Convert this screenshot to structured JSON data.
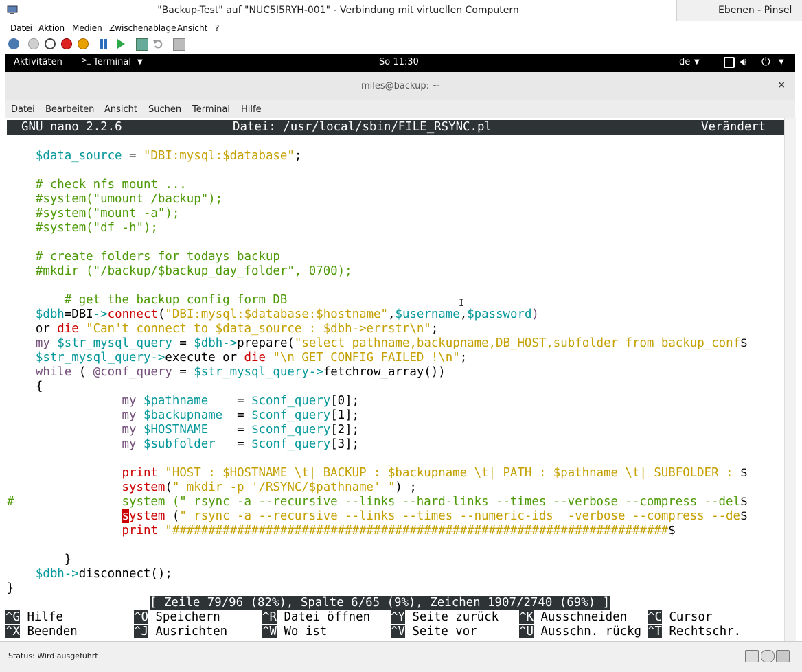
{
  "hyperv": {
    "title": "\"Backup-Test\" auf \"NUC5I5RYH-001\" - Verbindung mit virtuellen Computern",
    "right_app_title": "Ebenen - Pinsel",
    "menu": [
      "Datei",
      "Aktion",
      "Medien",
      "Zwischenablage",
      "Ansicht",
      "?"
    ],
    "status": "Status: Wird ausgeführt"
  },
  "gnome": {
    "activities": "Aktivitäten",
    "app_menu": "Terminal",
    "clock": "So 11:30",
    "keyboard": "de"
  },
  "terminal": {
    "title": "miles@backup: ~",
    "close": "×",
    "menu": [
      "Datei",
      "Bearbeiten",
      "Ansicht",
      "Suchen",
      "Terminal",
      "Hilfe"
    ]
  },
  "nano": {
    "version": "GNU nano 2.2.6",
    "file": "Datei: /usr/local/sbin/FILE_RSYNC.pl",
    "modified": "Verändert",
    "status": "[ Zeile 79/96 (82%), Spalte 6/65 (9%), Zeichen 1907/2740 (69%) ]",
    "shortcuts_row1": [
      {
        "key": "^G",
        "label": "Hilfe"
      },
      {
        "key": "^O",
        "label": "Speichern"
      },
      {
        "key": "^R",
        "label": "Datei öffnen"
      },
      {
        "key": "^Y",
        "label": "Seite zurück"
      },
      {
        "key": "^K",
        "label": "Ausschneiden"
      },
      {
        "key": "^C",
        "label": "Cursor"
      }
    ],
    "shortcuts_row2": [
      {
        "key": "^X",
        "label": "Beenden"
      },
      {
        "key": "^J",
        "label": "Ausrichten"
      },
      {
        "key": "^W",
        "label": "Wo ist"
      },
      {
        "key": "^V",
        "label": "Seite vor"
      },
      {
        "key": "^U",
        "label": "Ausschn. rückg"
      },
      {
        "key": "^T",
        "label": "Rechtschr."
      }
    ]
  },
  "code": [
    [
      [
        "    ",
        ""
      ],
      [
        "$data_source",
        "v"
      ],
      [
        " = ",
        ""
      ],
      [
        "\"DBI:mysql:$database\"",
        "s"
      ],
      [
        ";",
        ""
      ]
    ],
    [],
    [
      [
        "    ",
        ""
      ],
      [
        "# check nfs mount ...",
        "c"
      ]
    ],
    [
      [
        "    ",
        ""
      ],
      [
        "#system(\"umount /backup\");",
        "c"
      ]
    ],
    [
      [
        "    ",
        ""
      ],
      [
        "#system(\"mount -a\");",
        "c"
      ]
    ],
    [
      [
        "    ",
        ""
      ],
      [
        "#system(\"df -h\");",
        "c"
      ]
    ],
    [],
    [
      [
        "    ",
        ""
      ],
      [
        "# create folders for todays backup",
        "c"
      ]
    ],
    [
      [
        "    ",
        ""
      ],
      [
        "#mkdir (\"/backup/$backup_day_folder\", 0700);",
        "c"
      ]
    ],
    [],
    [
      [
        "        ",
        ""
      ],
      [
        "# get the backup config form DB",
        "c"
      ]
    ],
    [
      [
        "    ",
        ""
      ],
      [
        "$dbh",
        "v"
      ],
      [
        "=DBI",
        ""
      ],
      [
        "->",
        "v"
      ],
      [
        "connect",
        "r"
      ],
      [
        "(",
        ""
      ],
      [
        "\"DBI:mysql:$database:$hostname\"",
        "s"
      ],
      [
        ",",
        ""
      ],
      [
        "$username",
        "v"
      ],
      [
        ",",
        ""
      ],
      [
        "$password",
        "v"
      ],
      [
        ")",
        "k"
      ]
    ],
    [
      [
        "    or ",
        ""
      ],
      [
        "die",
        "r"
      ],
      [
        " ",
        ""
      ],
      [
        "\"Can't connect to $data_source : $dbh->errstr\\n\"",
        "s"
      ],
      [
        ";",
        ""
      ]
    ],
    [
      [
        "    ",
        ""
      ],
      [
        "my",
        "k"
      ],
      [
        " ",
        ""
      ],
      [
        "$str_mysql_query",
        "v"
      ],
      [
        " = ",
        ""
      ],
      [
        "$dbh",
        "v"
      ],
      [
        "->",
        "v"
      ],
      [
        "prepare(",
        ""
      ],
      [
        "\"select pathname,backupname,DB_HOST,subfolder from backup_conf",
        "s"
      ],
      [
        "$",
        ""
      ]
    ],
    [
      [
        "    ",
        ""
      ],
      [
        "$str_mysql_query",
        "v"
      ],
      [
        "->",
        "v"
      ],
      [
        "execute or ",
        ""
      ],
      [
        "die",
        "r"
      ],
      [
        " ",
        ""
      ],
      [
        "\"\\n GET CONFIG FAILED !\\n\"",
        "s"
      ],
      [
        ";",
        ""
      ]
    ],
    [
      [
        "    ",
        ""
      ],
      [
        "while",
        "k"
      ],
      [
        " ( ",
        ""
      ],
      [
        "@conf_query",
        "k"
      ],
      [
        " = ",
        ""
      ],
      [
        "$str_mysql_query",
        "v"
      ],
      [
        "->",
        "v"
      ],
      [
        "fetchrow_array())",
        ""
      ]
    ],
    [
      [
        "    {",
        ""
      ]
    ],
    [
      [
        "                ",
        ""
      ],
      [
        "my",
        "k"
      ],
      [
        " ",
        ""
      ],
      [
        "$pathname",
        "v"
      ],
      [
        "    = ",
        ""
      ],
      [
        "$conf_query",
        "v"
      ],
      [
        "[0];",
        ""
      ]
    ],
    [
      [
        "                ",
        ""
      ],
      [
        "my",
        "k"
      ],
      [
        " ",
        ""
      ],
      [
        "$backupname",
        "v"
      ],
      [
        "  = ",
        ""
      ],
      [
        "$conf_query",
        "v"
      ],
      [
        "[1];",
        ""
      ]
    ],
    [
      [
        "                ",
        ""
      ],
      [
        "my",
        "k"
      ],
      [
        " ",
        ""
      ],
      [
        "$HOSTNAME",
        "v"
      ],
      [
        "    = ",
        ""
      ],
      [
        "$conf_query",
        "v"
      ],
      [
        "[2];",
        ""
      ]
    ],
    [
      [
        "                ",
        ""
      ],
      [
        "my",
        "k"
      ],
      [
        " ",
        ""
      ],
      [
        "$subfolder",
        "v"
      ],
      [
        "   = ",
        ""
      ],
      [
        "$conf_query",
        "v"
      ],
      [
        "[3];",
        ""
      ]
    ],
    [],
    [
      [
        "                ",
        ""
      ],
      [
        "print",
        "r"
      ],
      [
        " ",
        ""
      ],
      [
        "\"HOST : $HOSTNAME \\t| BACKUP : $backupname \\t| PATH : $pathname \\t| SUBFOLDER : ",
        "s"
      ],
      [
        "$",
        ""
      ]
    ],
    [
      [
        "                ",
        ""
      ],
      [
        "system",
        "r"
      ],
      [
        "(",
        ""
      ],
      [
        "\" mkdir -p '/RSYNC/$pathname' \"",
        "s"
      ],
      [
        ") ;",
        ""
      ]
    ],
    [
      [
        "#               ",
        "c"
      ],
      [
        "system (\" rsync -a --recursive --links --hard-links --times --verbose --compress --del",
        "c"
      ],
      [
        "$",
        ""
      ]
    ],
    [
      [
        "                ",
        ""
      ],
      [
        "s",
        "cur"
      ],
      [
        "ystem",
        "r"
      ],
      [
        " (",
        ""
      ],
      [
        "\" rsync -a --recursive --links --times --numeric-ids  -verbose --compress --de",
        "s"
      ],
      [
        "$",
        ""
      ]
    ],
    [
      [
        "                ",
        ""
      ],
      [
        "print",
        "r"
      ],
      [
        " ",
        ""
      ],
      [
        "\"#####################################################################",
        "s"
      ],
      [
        "$",
        ""
      ]
    ],
    [],
    [
      [
        "        }",
        ""
      ]
    ],
    [
      [
        "    ",
        ""
      ],
      [
        "$dbh",
        "v"
      ],
      [
        "->",
        "v"
      ],
      [
        "disconnect();",
        ""
      ]
    ],
    [
      [
        "}",
        ""
      ]
    ]
  ]
}
